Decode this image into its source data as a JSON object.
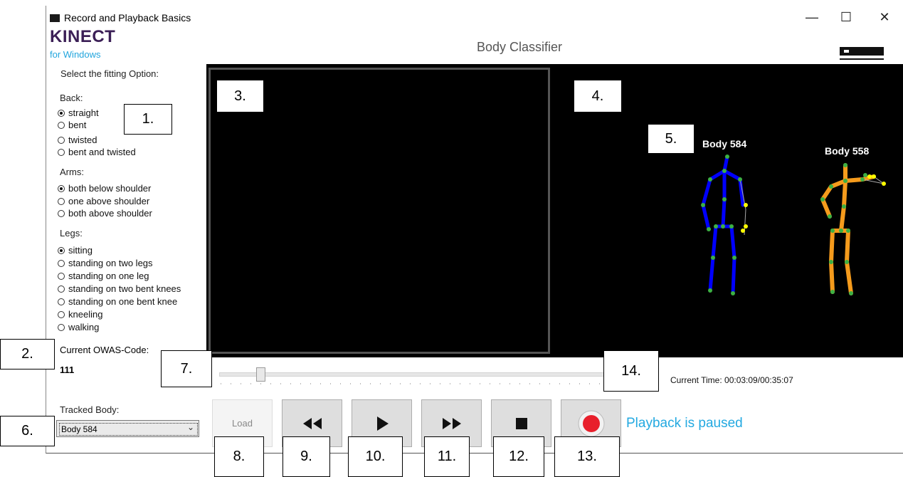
{
  "window": {
    "title": "Record and Playback Basics",
    "minimize": "—",
    "maximize": "☐",
    "close": "✕"
  },
  "logo": {
    "main": "KINECT",
    "sub": "for Windows"
  },
  "header_title": "Body Classifier",
  "sidebar": {
    "select_label": "Select the fitting Option:",
    "back": {
      "label": "Back:",
      "options": [
        "straight",
        "bent",
        "twisted",
        "bent and twisted"
      ],
      "selected": "straight"
    },
    "arms": {
      "label": "Arms:",
      "options": [
        "both below shoulder",
        "one above shoulder",
        "both above shoulder"
      ],
      "selected": "both below shoulder"
    },
    "legs": {
      "label": "Legs:",
      "options": [
        "sitting",
        "standing on two legs",
        "standing on one leg",
        "standing on two bent knees",
        "standing on one bent knee",
        "kneeling",
        "walking"
      ],
      "selected": "sitting"
    },
    "owas_label": "Current OWAS-Code:",
    "owas_value": "111",
    "tracked_label": "Tracked Body:",
    "tracked_value": "Body 584"
  },
  "bodies": [
    {
      "label": "Body 584",
      "color": "#0000ff"
    },
    {
      "label": "Body 558",
      "color": "#f59b1c"
    }
  ],
  "playback": {
    "current_time_label": "Current Time: 00:03:09/00:35:07",
    "load_label": "Load",
    "status": "Playback is paused"
  },
  "callouts": [
    "1.",
    "2.",
    "3.",
    "4.",
    "5.",
    "6.",
    "7.",
    "8.",
    "9.",
    "10.",
    "11.",
    "12.",
    "13.",
    "14."
  ],
  "colors": {
    "accent": "#23a9e1",
    "logo": "#3b1f56",
    "joint": "#3cb043",
    "hand": "#ffff00"
  }
}
